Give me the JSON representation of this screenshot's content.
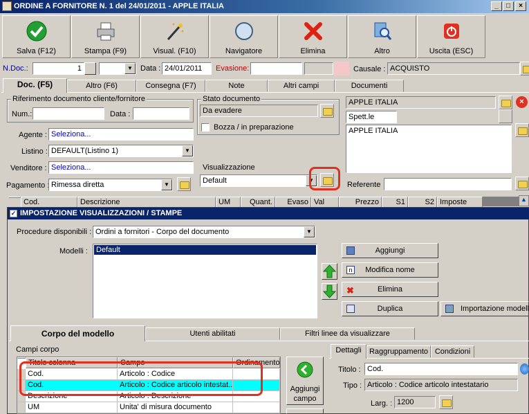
{
  "window": {
    "title": "ORDINE A FORNITORE N. 1  del 24/01/2011 - APPLE ITALIA",
    "minimize": "_",
    "maximize": "□",
    "close": "×"
  },
  "toolbar": [
    {
      "label": "Salva (F12)",
      "icon": "save-check-icon"
    },
    {
      "label": "Stampa (F9)",
      "icon": "printer-icon"
    },
    {
      "label": "Visual. (F10)",
      "icon": "magic-wand-icon"
    },
    {
      "label": "Navigatore",
      "icon": "compass-icon"
    },
    {
      "label": "Elimina",
      "icon": "delete-x-icon"
    },
    {
      "label": "Altro",
      "icon": "magnifier-icon"
    },
    {
      "label": "Uscita (ESC)",
      "icon": "exit-power-icon"
    }
  ],
  "header": {
    "ndoc_label": "N.Doc.:",
    "ndoc_value": "1",
    "data_label": "Data :",
    "data_value": "24/01/2011",
    "evasione_label": "Evasione:",
    "causale_label": "Causale :",
    "causale_value": "ACQUISTO"
  },
  "tabs": [
    "Doc. (F5)",
    "Altro (F6)",
    "Consegna (F7)",
    "Note",
    "Altri campi",
    "Documenti"
  ],
  "doc": {
    "rif_legend": "Riferimento documento cliente/fornitore",
    "num_label": "Num.:",
    "data_label": "Data :",
    "agente_label": "Agente :",
    "agente_value": "Seleziona...",
    "listino_label": "Listino :",
    "listino_value": "DEFAULT(Listino 1)",
    "venditore_label": "Venditore :",
    "venditore_value": "Seleziona...",
    "pagamento_label": "Pagamento :",
    "pagamento_value": "Rimessa diretta",
    "stato_legend": "Stato documento",
    "stato_value": "Da evadere",
    "bozza_label": "Bozza / in preparazione",
    "visual_legend": "Visualizzazione",
    "visual_value": "Default",
    "fornitore_name": "APPLE ITALIA",
    "spett": "Spett.le",
    "address": "APPLE ITALIA",
    "referente_label": "Referente"
  },
  "grid_columns": [
    "Cod.",
    "Descrizione",
    "UM",
    "Quant.",
    "Evaso",
    "Val",
    "Prezzo",
    "S1",
    "S2",
    "Imposte"
  ],
  "dialog": {
    "title": "IMPOSTAZIONE VISUALIZZAZIONI / STAMPE",
    "procedure_label": "Procedure disponibili :",
    "procedure_value": "Ordini a fornitori - Corpo del documento",
    "modelli_label": "Modelli :",
    "modelli": [
      "Default"
    ],
    "buttons": {
      "aggiungi": "Aggiungi",
      "modifica": "Modifica nome",
      "elimina": "Elimina",
      "duplica": "Duplica",
      "importazione": "Importazione modello"
    },
    "tabs": [
      "Corpo del modello",
      "Utenti abilitati",
      "Filtri linee da visualizzare"
    ],
    "campi_label": "Campi corpo",
    "campi_headers": [
      "Titolo colonna",
      "Campo",
      "Ordinamento"
    ],
    "campi_rows": [
      {
        "titolo": "Cod.",
        "campo": "Articolo : Codice",
        "ord": ""
      },
      {
        "titolo": "Cod.",
        "campo": "Articolo : Codice articolo intestat...",
        "ord": ""
      },
      {
        "titolo": "Descrizione",
        "campo": "Articolo : Descrizione",
        "ord": ""
      },
      {
        "titolo": "UM",
        "campo": "Unita' di misura documento",
        "ord": ""
      }
    ],
    "aggiungi_campo": [
      "Aggiungi",
      "campo"
    ],
    "detail_tabs": [
      "Dettagli",
      "Raggruppamento",
      "Condizioni"
    ],
    "titolo_label": "Titolo :",
    "titolo_value": "Cod.",
    "tipo_label": "Tipo :",
    "tipo_value": "Articolo : Codice articolo intestatario",
    "larg_label": "Larg. :",
    "larg_value": "1200"
  }
}
